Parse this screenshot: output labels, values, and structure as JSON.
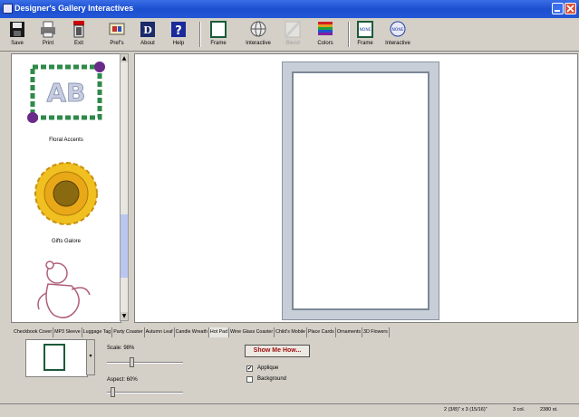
{
  "window": {
    "title": "Designer's Gallery Interactives"
  },
  "toolbar": {
    "buttons": [
      {
        "label": "Save",
        "icon": "floppy-disk-icon"
      },
      {
        "label": "Print",
        "icon": "printer-icon"
      },
      {
        "label": "Exit",
        "icon": "exit-door-icon"
      },
      {
        "label": "Pref's",
        "icon": "preferences-icon"
      },
      {
        "label": "About",
        "icon": "about-icon"
      },
      {
        "label": "Help",
        "icon": "help-icon"
      },
      {
        "label": "Frame",
        "icon": "frame-icon"
      },
      {
        "label": "Interactive",
        "icon": "interactive-globe-icon"
      },
      {
        "label": "Blend",
        "icon": "blend-icon"
      },
      {
        "label": "Colors",
        "icon": "colors-icon"
      },
      {
        "label": "Frame",
        "icon": "none-frame-icon",
        "badge": "NONE"
      },
      {
        "label": "Interactive",
        "icon": "none-interactive-icon",
        "badge": "NONE"
      }
    ]
  },
  "designs": [
    {
      "caption": "Floral Accents"
    },
    {
      "caption": "Gifts Galore"
    },
    {
      "caption": ""
    }
  ],
  "project_tabs": [
    "Checkbook Cover",
    "MP3 Sleeve",
    "Luggage Tag",
    "Party Coaster",
    "Autumn Leaf",
    "Candle Wreath",
    "Hot Pad",
    "Wine Glass Coaster",
    "Child's Mobile",
    "Place Cards",
    "Ornaments",
    "3D Flowers"
  ],
  "active_tab": "Hot Pad",
  "controls": {
    "scale_label": "Scale: 98%",
    "scale_value": 0.98,
    "aspect_label": "Aspect: 60%",
    "aspect_value": 0.6,
    "show_me_label": "Show Me How...",
    "applique_label": "Applique",
    "applique_checked": true,
    "background_label": "Background",
    "background_checked": false
  },
  "status": {
    "size": "2 (3/8)\" x 3 (15/16)\"",
    "colors": "3 col.",
    "stitches": "2380 st."
  },
  "colors": {
    "titlebar": "#1c4fd0",
    "show_me_text": "#a01010",
    "frame_fill": "#c7ced8"
  }
}
